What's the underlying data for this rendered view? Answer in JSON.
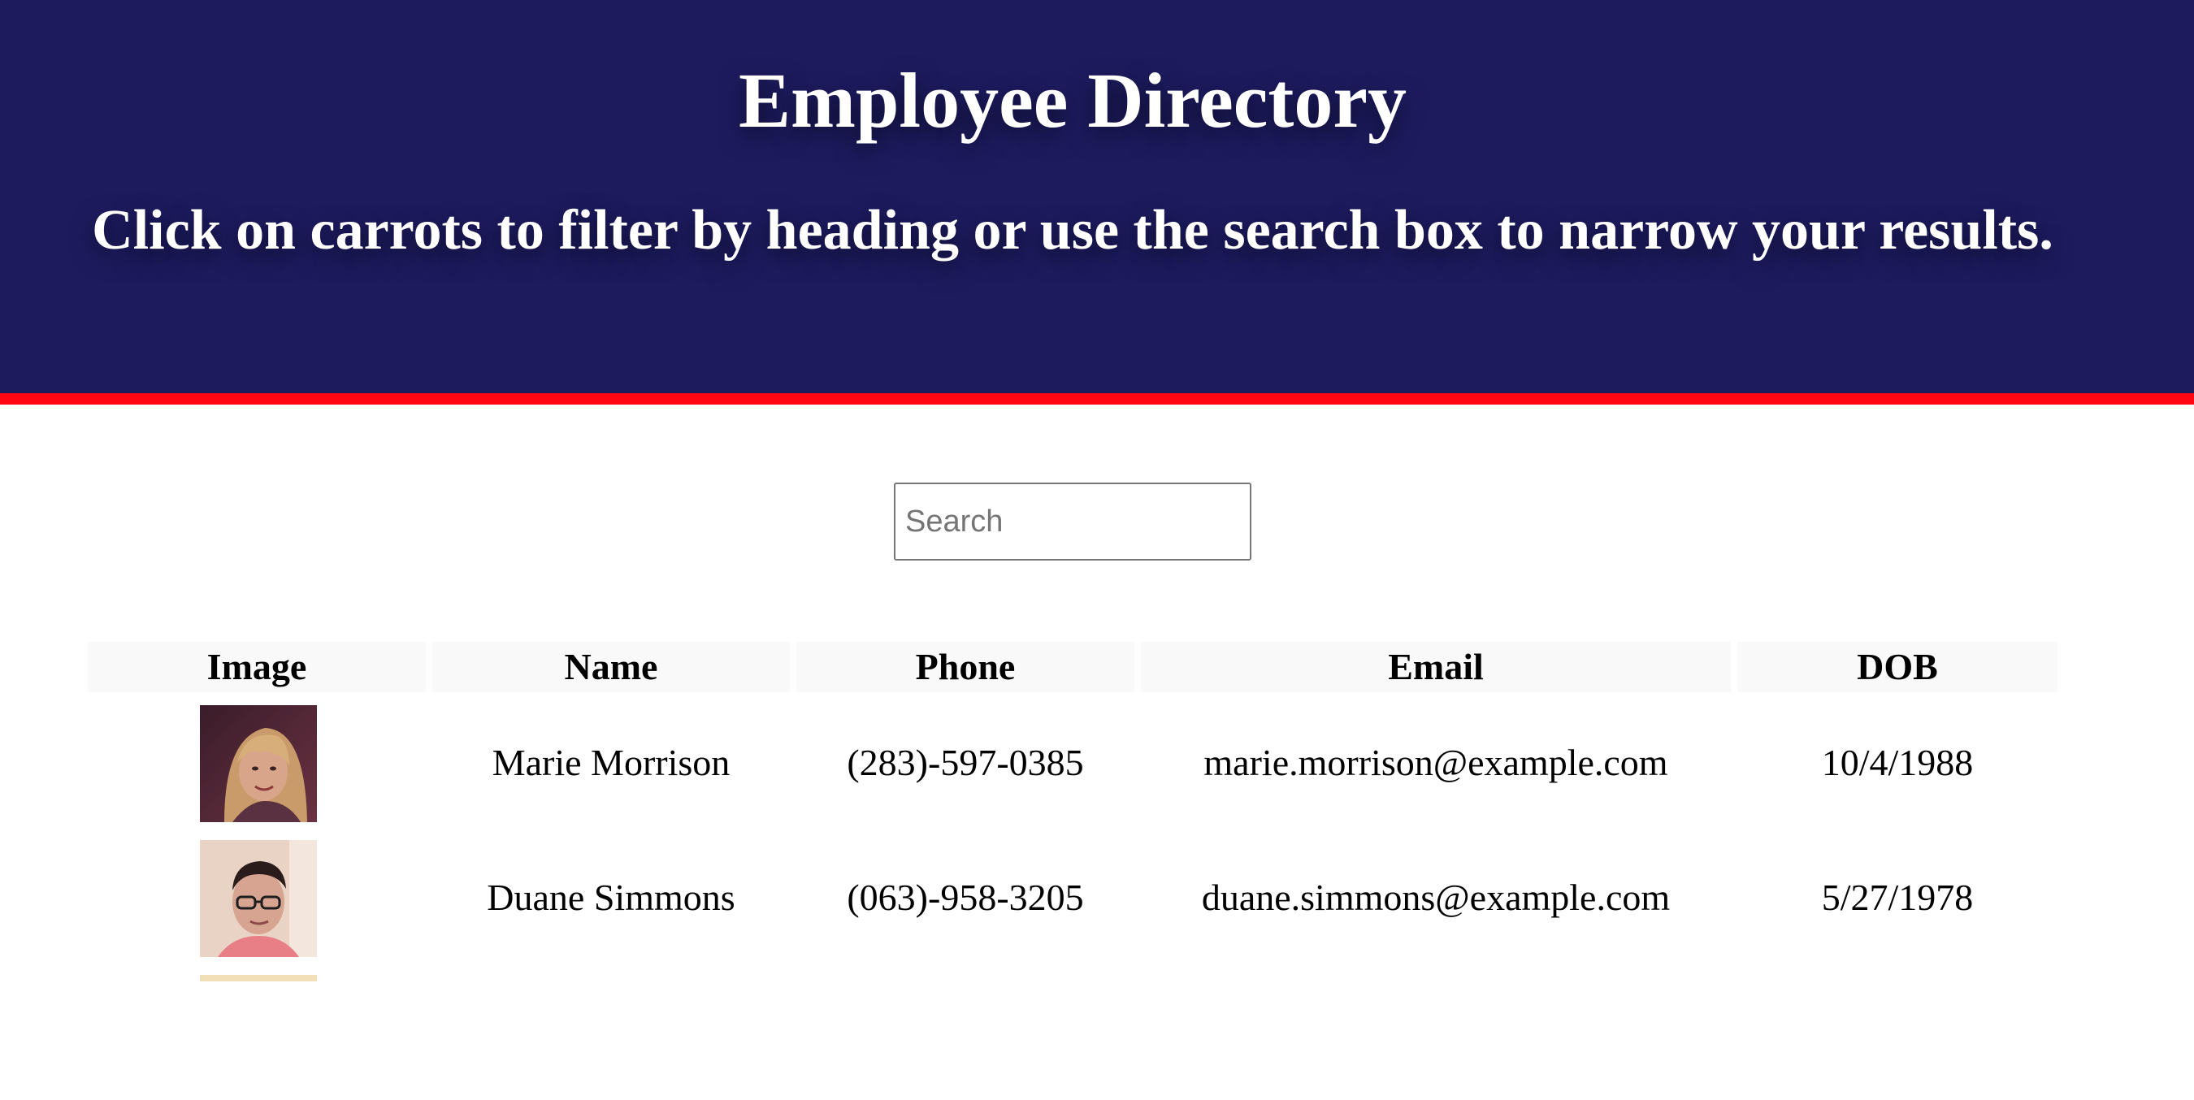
{
  "header": {
    "title": "Employee Directory",
    "subtitle": "Click on carrots to filter by heading or use the search box to narrow your results."
  },
  "search": {
    "placeholder": "Search",
    "value": ""
  },
  "table": {
    "columns": [
      "Image",
      "Name",
      "Phone",
      "Email",
      "DOB"
    ],
    "rows": [
      {
        "name": "Marie Morrison",
        "phone": "(283)-597-0385",
        "email": "marie.morrison@example.com",
        "dob": "10/4/1988"
      },
      {
        "name": "Duane Simmons",
        "phone": "(063)-958-3205",
        "email": "duane.simmons@example.com",
        "dob": "5/27/1978"
      }
    ]
  },
  "colors": {
    "header_bg": "#1d1b5e",
    "accent_bar": "#ff0612",
    "table_header_bg": "#f9f9f9"
  }
}
